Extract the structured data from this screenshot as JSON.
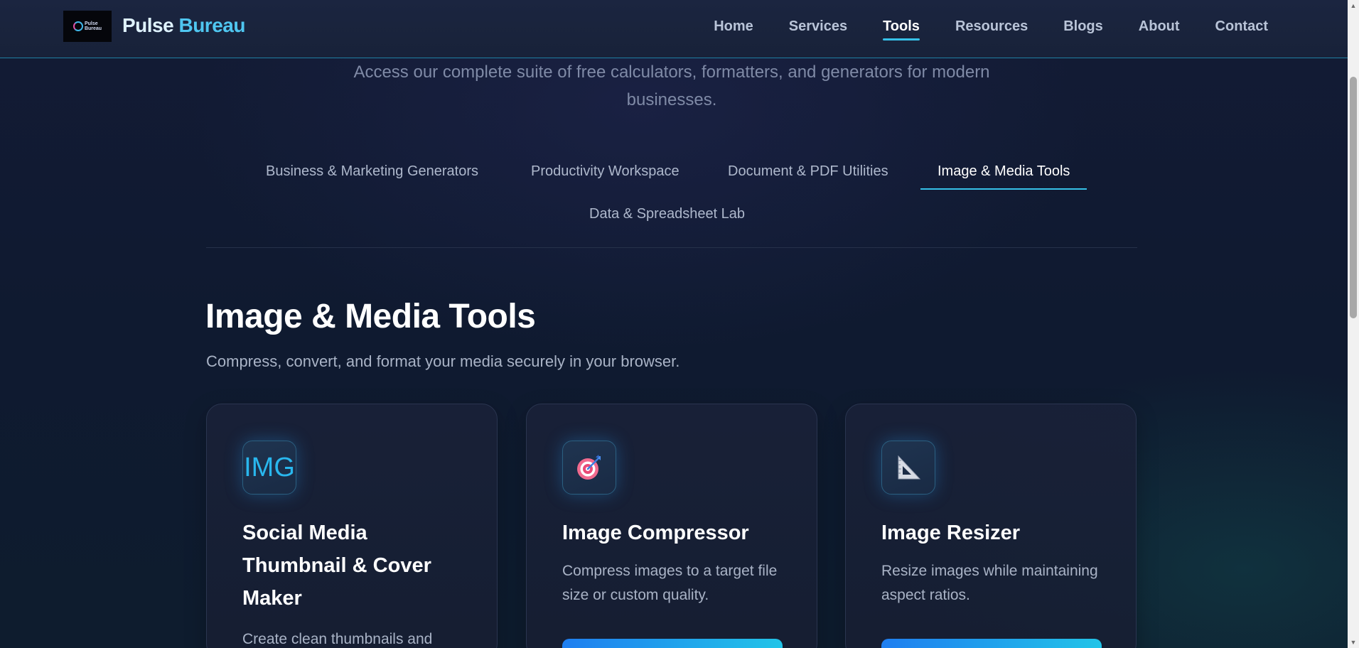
{
  "header": {
    "brand_part1": "Pulse",
    "brand_part2": "Bureau",
    "logo_text_top": "Pulse",
    "logo_text_bottom": "Bureau",
    "nav": [
      {
        "label": "Home",
        "active": false
      },
      {
        "label": "Services",
        "active": false
      },
      {
        "label": "Tools",
        "active": true
      },
      {
        "label": "Resources",
        "active": false
      },
      {
        "label": "Blogs",
        "active": false
      },
      {
        "label": "About",
        "active": false
      },
      {
        "label": "Contact",
        "active": false
      }
    ]
  },
  "intro": {
    "subtitle": "Access our complete suite of free calculators, formatters, and generators for modern businesses."
  },
  "tabs": [
    {
      "label": "Business & Marketing Generators",
      "active": false
    },
    {
      "label": "Productivity Workspace",
      "active": false
    },
    {
      "label": "Document & PDF Utilities",
      "active": false
    },
    {
      "label": "Image & Media Tools",
      "active": true
    },
    {
      "label": "Data & Spreadsheet Lab",
      "active": false
    }
  ],
  "section": {
    "title": "Image & Media Tools",
    "description": "Compress, convert, and format your media securely in your browser."
  },
  "cards": [
    {
      "icon": "img-text-icon",
      "icon_text": "IMG",
      "title": "Social Media Thumbnail & Cover Maker",
      "description": "Create clean thumbnails and"
    },
    {
      "icon": "target-icon",
      "title": "Image Compressor",
      "description": "Compress images to a target file size or custom quality."
    },
    {
      "icon": "set-square-icon",
      "title": "Image Resizer",
      "description": "Resize images while maintaining aspect ratios."
    }
  ],
  "colors": {
    "accent": "#36c1e8",
    "brand_highlight": "#4fc6f0",
    "background": "#0f1a2e"
  }
}
